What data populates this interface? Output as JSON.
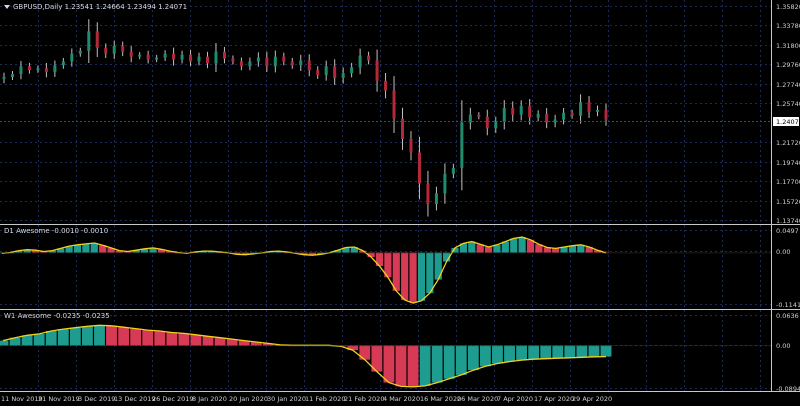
{
  "colors": {
    "background": "#000000",
    "grid": "#1c2a5a",
    "up_body": "#1e8c6e",
    "down_body": "#b22a3a",
    "wick": "#c0c0c0",
    "ao_up": "#1e9c90",
    "ao_down": "#d63a55",
    "ao_line": "#f2d21a",
    "separator": "#c8c8c8",
    "price_label_bg": "#ffffff",
    "axis_text": "#d0d0d0"
  },
  "main": {
    "title": "GBPUSD,Daily  1.23541 1.24664 1.23494 1.24071",
    "current_price": "1.24071",
    "y_ticks": [
      "1.35820",
      "1.33780",
      "1.31800",
      "1.29760",
      "1.27740",
      "1.25740",
      "1.21720",
      "1.19740",
      "1.17700",
      "1.15720",
      "1.13740"
    ]
  },
  "sub1": {
    "title": "D1 Awesome -0.0010 -0.0010",
    "y_ticks": [
      "0.0497",
      "0.00",
      "-0.1141"
    ]
  },
  "sub2": {
    "title": "W1 Awesome -0.0235 -0.0235",
    "y_ticks": [
      "0.0636",
      "0.00",
      "-0.0894"
    ]
  },
  "x_ticks": [
    "11 Nov 2019",
    "21 Nov 2019",
    "3 Dec 2019",
    "13 Dec 2019",
    "26 Dec 2019",
    "8 Jan 2020",
    "20 Jan 2020",
    "30 Jan 2020",
    "11 Feb 2020",
    "21 Feb 2020",
    "4 Mar 2020",
    "16 Mar 2020",
    "26 Mar 2020",
    "7 Apr 2020",
    "17 Apr 2020",
    "29 Apr 2020"
  ],
  "chart_data": [
    {
      "type": "candlestick",
      "title": "GBPUSD,Daily",
      "ylim": [
        1.1374,
        1.3582
      ],
      "x": [
        "11 Nov 2019",
        "21 Nov 2019",
        "3 Dec 2019",
        "13 Dec 2019",
        "26 Dec 2019",
        "8 Jan 2020",
        "20 Jan 2020",
        "30 Jan 2020",
        "11 Feb 2020",
        "21 Feb 2020",
        "4 Mar 2020",
        "16 Mar 2020",
        "26 Mar 2020",
        "7 Apr 2020",
        "17 Apr 2020",
        "29 Apr 2020"
      ],
      "closes": [
        1.285,
        1.288,
        1.296,
        1.292,
        1.294,
        1.29,
        1.297,
        1.301,
        1.309,
        1.312,
        1.332,
        1.315,
        1.309,
        1.317,
        1.311,
        1.306,
        1.308,
        1.303,
        1.305,
        1.309,
        1.303,
        1.308,
        1.301,
        1.306,
        1.299,
        1.311,
        1.304,
        1.301,
        1.296,
        1.301,
        1.305,
        1.296,
        1.306,
        1.301,
        1.297,
        1.302,
        1.292,
        1.287,
        1.296,
        1.284,
        1.289,
        1.295,
        1.307,
        1.302,
        1.281,
        1.271,
        1.242,
        1.221,
        1.207,
        1.175,
        1.154,
        1.165,
        1.185,
        1.191,
        1.238,
        1.246,
        1.244,
        1.232,
        1.239,
        1.253,
        1.246,
        1.255,
        1.243,
        1.247,
        1.238,
        1.241,
        1.248,
        1.245,
        1.259,
        1.249,
        1.251,
        1.241
      ],
      "unit": "USD per GBP"
    },
    {
      "type": "bar",
      "title": "D1 Awesome",
      "ylim": [
        -0.1141,
        0.0497
      ],
      "values": [
        -0.002,
        0.0,
        0.004,
        0.006,
        0.005,
        0.002,
        0.004,
        0.009,
        0.014,
        0.017,
        0.019,
        0.021,
        0.016,
        0.01,
        0.004,
        0.002,
        0.005,
        0.008,
        0.01,
        0.007,
        0.003,
        0.0,
        -0.002,
        0.001,
        0.003,
        0.003,
        0.001,
        -0.001,
        -0.004,
        -0.005,
        -0.003,
        -0.001,
        0.002,
        0.003,
        0.001,
        -0.002,
        -0.005,
        -0.006,
        -0.004,
        -0.001,
        0.005,
        0.011,
        0.012,
        0.004,
        -0.01,
        -0.03,
        -0.055,
        -0.085,
        -0.105,
        -0.112,
        -0.107,
        -0.09,
        -0.06,
        -0.02,
        0.01,
        0.02,
        0.024,
        0.018,
        0.012,
        0.017,
        0.024,
        0.031,
        0.034,
        0.028,
        0.018,
        0.011,
        0.009,
        0.012,
        0.015,
        0.017,
        0.012,
        0.005,
        -0.001
      ]
    },
    {
      "type": "bar",
      "title": "W1 Awesome",
      "ylim": [
        -0.0894,
        0.0636
      ],
      "values": [
        0.01,
        0.016,
        0.021,
        0.024,
        0.03,
        0.034,
        0.037,
        0.04,
        0.042,
        0.041,
        0.038,
        0.035,
        0.032,
        0.03,
        0.027,
        0.025,
        0.022,
        0.019,
        0.016,
        0.013,
        0.01,
        0.007,
        0.004,
        0.001,
        0.0,
        0.0,
        0.0,
        0.0,
        -0.002,
        -0.01,
        -0.03,
        -0.055,
        -0.078,
        -0.086,
        -0.087,
        -0.085,
        -0.078,
        -0.07,
        -0.062,
        -0.052,
        -0.044,
        -0.038,
        -0.034,
        -0.031,
        -0.029,
        -0.028,
        -0.027,
        -0.026,
        -0.025,
        -0.024,
        -0.0235
      ]
    }
  ]
}
